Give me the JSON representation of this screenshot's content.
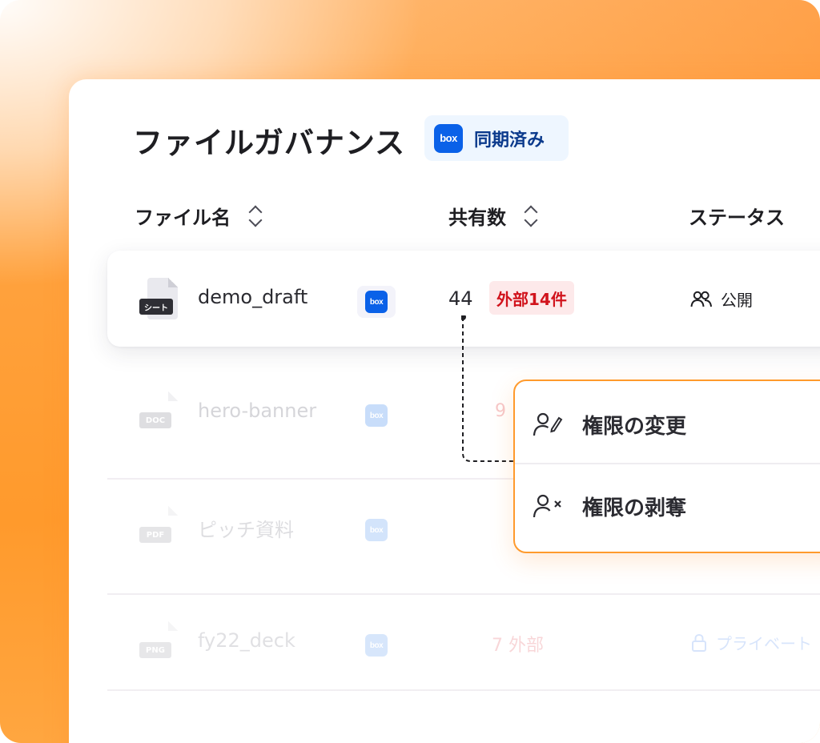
{
  "header": {
    "title": "ファイルガバナンス",
    "sync_badge": {
      "logo_text": "box",
      "label": "同期済み"
    }
  },
  "columns": {
    "file_name": "ファイル名",
    "share_count": "共有数",
    "status": "ステータス"
  },
  "rows": [
    {
      "file_type": "シート",
      "name": "demo_draft",
      "logo_text": "box",
      "share_count": "44",
      "external": "外部14件",
      "status": "公開"
    },
    {
      "file_type": "DOC",
      "name": "hero-banner",
      "logo_text": "box",
      "share_count": "9",
      "external": "",
      "status": ""
    },
    {
      "file_type": "PDF",
      "name": "ピッチ資料",
      "logo_text": "box",
      "share_count": "",
      "external": "",
      "status": ""
    },
    {
      "file_type": "PNG",
      "name": "fy22_deck",
      "logo_text": "box",
      "share_count": "",
      "external": "7 外部",
      "status": "プライベート"
    }
  ],
  "context_menu": {
    "change_permission": "権限の変更",
    "revoke_permission": "権限の剥奪"
  },
  "colors": {
    "accent_orange": "#ff9a2c",
    "box_blue": "#0a61e8",
    "external_red": "#d1131c",
    "external_bg": "#fde9ea",
    "sync_bg": "#eef6ff"
  }
}
